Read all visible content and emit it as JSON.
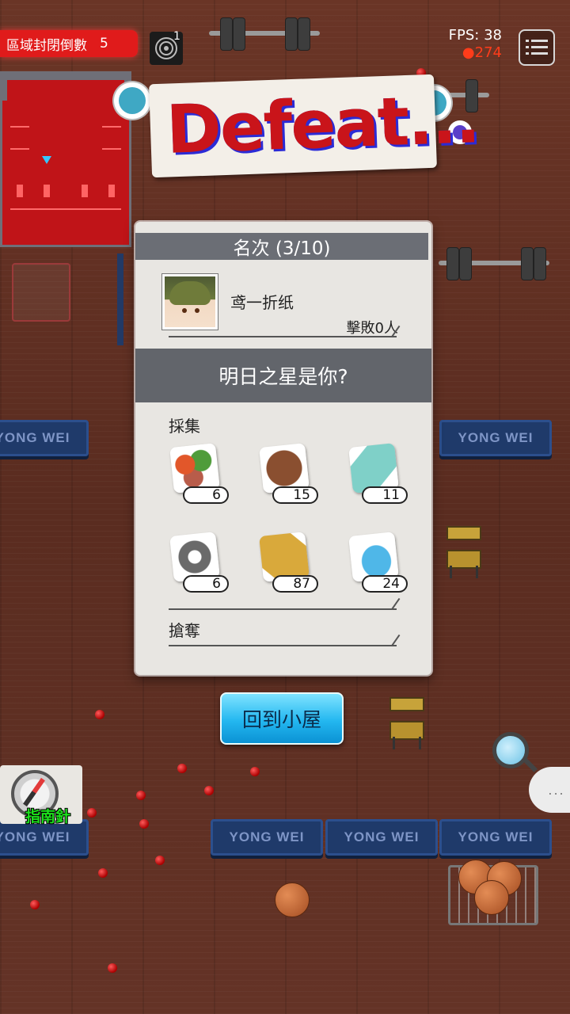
{
  "hud": {
    "zone_label": "區域封閉倒數",
    "zone_count": "5",
    "radar_count": "1",
    "fps_text": "FPS: 38",
    "ping_text": "274"
  },
  "banner": {
    "title": "Defeat..."
  },
  "floor": {
    "bench_text": "YONG WEI"
  },
  "result": {
    "rank_text": "名次 (3/10)",
    "player_name": "鸢一折纸",
    "kills_text": "擊敗0人",
    "message": "明日之星是你?",
    "collect_label": "採集",
    "loot_label": "搶奪",
    "items": [
      {
        "icon": "vegetables-icon",
        "count": "6"
      },
      {
        "icon": "leather-icon",
        "count": "15"
      },
      {
        "icon": "cloth-icon",
        "count": "11"
      },
      {
        "icon": "gear-icon",
        "count": "6"
      },
      {
        "icon": "crate-icon",
        "count": "87"
      },
      {
        "icon": "water-bottle-icon",
        "count": "24"
      }
    ]
  },
  "home_button": "回到小屋",
  "compass_label": "指南針",
  "chat_text": "...",
  "colors": {
    "zone_red": "#e01b1b",
    "button_blue": "#23b7f0",
    "panel": "#e8e6e2",
    "bench_blue": "#1f3a6a"
  }
}
